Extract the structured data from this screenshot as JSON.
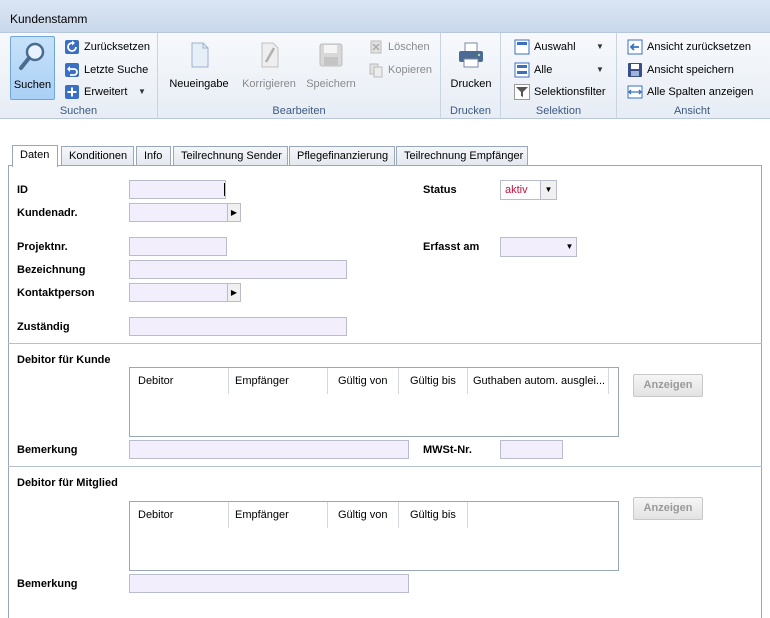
{
  "window": {
    "title": "Kundenstamm"
  },
  "ribbon": {
    "suchen": {
      "group_label": "Suchen",
      "search_label": "Suchen",
      "reset_label": "Zurücksetzen",
      "last_search_label": "Letzte Suche",
      "extended_label": "Erweitert"
    },
    "bearbeiten": {
      "group_label": "Bearbeiten",
      "new_label": "Neueingabe",
      "correct_label": "Korrigieren",
      "save_label": "Speichern",
      "delete_label": "Löschen",
      "copy_label": "Kopieren"
    },
    "drucken": {
      "group_label": "Drucken",
      "print_label": "Drucken"
    },
    "selektion": {
      "group_label": "Selektion",
      "auswahl_label": "Auswahl",
      "alle_label": "Alle",
      "filter_label": "Selektionsfilter"
    },
    "ansicht": {
      "group_label": "Ansicht",
      "reset_view_label": "Ansicht zurücksetzen",
      "save_view_label": "Ansicht speichern",
      "show_all_columns_label": "Alle Spalten anzeigen"
    }
  },
  "tabs": [
    "Daten",
    "Konditionen",
    "Info",
    "Teilrechnung Sender",
    "Pflegefinanzierung",
    "Teilrechnung Empfänger"
  ],
  "form": {
    "id_label": "ID",
    "kundenadr_label": "Kundenadr.",
    "projektnr_label": "Projektnr.",
    "bezeichnung_label": "Bezeichnung",
    "kontaktperson_label": "Kontaktperson",
    "zustaendig_label": "Zuständig",
    "status_label": "Status",
    "status_value": "aktiv",
    "erfasst_label": "Erfasst am"
  },
  "debitor_kunde": {
    "section_label": "Debitor für Kunde",
    "columns": [
      "Debitor",
      "Empfänger",
      "Gültig von",
      "Gültig bis",
      "Guthaben autom. ausglei..."
    ],
    "show_button": "Anzeigen",
    "bemerkung_label": "Bemerkung",
    "mwst_label": "MWSt-Nr."
  },
  "debitor_mitglied": {
    "section_label": "Debitor für Mitglied",
    "columns": [
      "Debitor",
      "Empfänger",
      "Gültig von",
      "Gültig bis"
    ],
    "show_button": "Anzeigen",
    "bemerkung_label": "Bemerkung"
  },
  "colors": {
    "accent": "#3d5a80",
    "status": "#c0143c",
    "field_bg": "#f2eefb"
  }
}
